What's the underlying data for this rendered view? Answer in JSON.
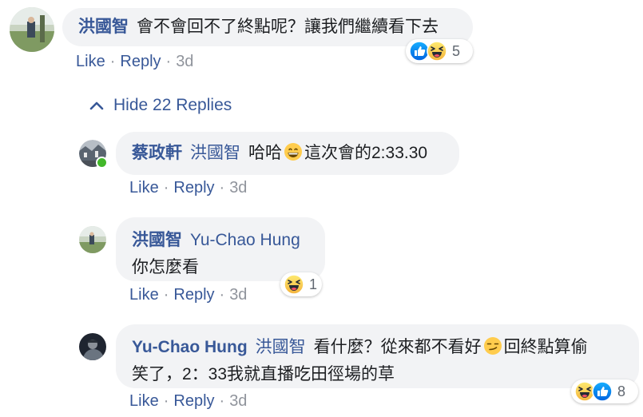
{
  "comments": [
    {
      "author": "洪國智",
      "mention": "",
      "text": "會不會回不了終點呢？讓我們繼續看下去",
      "actions": {
        "like": "Like",
        "reply": "Reply",
        "time": "3d"
      },
      "reactions": {
        "icons": [
          "like-icon",
          "laugh-icon"
        ],
        "count": "5"
      }
    }
  ],
  "hide_replies": {
    "label": "Hide 22 Replies",
    "icon": "chevron-up-icon"
  },
  "replies": [
    {
      "author": "蔡政軒",
      "mention": "洪國智",
      "text_before": "哈哈",
      "emoji": "grin-emoji",
      "text_after": "這次會的2:33.30",
      "online": true,
      "actions": {
        "like": "Like",
        "reply": "Reply",
        "time": "3d"
      }
    },
    {
      "author": "洪國智",
      "mention": "Yu-Chao Hung",
      "text": "你怎麼看",
      "actions": {
        "like": "Like",
        "reply": "Reply",
        "time": "3d"
      },
      "reactions": {
        "icons": [
          "laugh-icon"
        ],
        "count": "1"
      }
    },
    {
      "author": "Yu-Chao Hung",
      "mention": "洪國智",
      "text_before": "看什麼？從來都不看好",
      "emoji": "smirk-emoji",
      "text_after": "回終點算偷",
      "line2": "笑了，2：33我就直播吃田徑場的草",
      "actions": {
        "like": "Like",
        "reply": "Reply",
        "time": "3d"
      },
      "reactions": {
        "icons": [
          "laugh-icon",
          "like-icon"
        ],
        "count": "8"
      }
    }
  ],
  "colors": {
    "link": "#385898",
    "bubble": "#f2f3f5",
    "meta": "#90949c",
    "online": "#42b72a"
  }
}
